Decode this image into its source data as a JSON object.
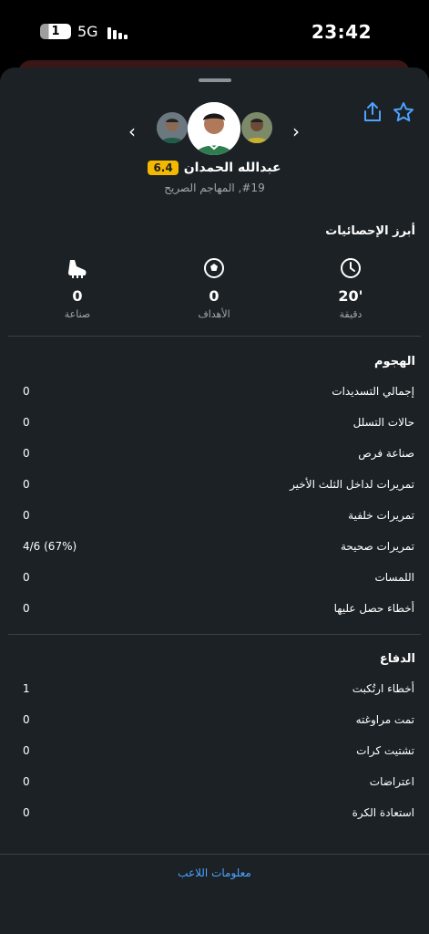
{
  "status_bar": {
    "sim": "1",
    "network": "5G",
    "time": "23:42"
  },
  "player": {
    "name": "عبدالله الحمدان",
    "rating": "6.4",
    "position": "#19, المهاجم الصريح"
  },
  "colors": {
    "accent": "#4da3ff",
    "rating_bg": "#f5b800",
    "sheet_bg": "#1b2125"
  },
  "top_stats": {
    "title": "أبرز الإحصائيات",
    "items": [
      {
        "icon": "boot-icon",
        "value": "0",
        "label": "صناعة"
      },
      {
        "icon": "football-icon",
        "value": "0",
        "label": "الأهداف"
      },
      {
        "icon": "clock-icon",
        "value": "20'",
        "label": "دقيقة"
      }
    ]
  },
  "attack": {
    "title": "الهجوم",
    "rows": [
      {
        "label": "إجمالي التسديدات",
        "value": "0"
      },
      {
        "label": "حالات التسلل",
        "value": "0"
      },
      {
        "label": "صناعة فرص",
        "value": "0"
      },
      {
        "label": "تمريرات لداخل الثلث الأخير",
        "value": "0"
      },
      {
        "label": "تمريرات خلفية",
        "value": "0"
      },
      {
        "label": "تمريرات صحيحة",
        "value": "4/6 (67%)"
      },
      {
        "label": "اللمسات",
        "value": "0"
      },
      {
        "label": "أخطاء حصل عليها",
        "value": "0"
      }
    ]
  },
  "defense": {
    "title": "الدفاع",
    "rows": [
      {
        "label": "أخطاء ارتُكبت",
        "value": "1"
      },
      {
        "label": "تمت مراوغته",
        "value": "0"
      },
      {
        "label": "تشتيت كرات",
        "value": "0"
      },
      {
        "label": "اعتراضات",
        "value": "0"
      },
      {
        "label": "استعادة الكرة",
        "value": "0"
      }
    ]
  },
  "footer": {
    "link": "معلومات اللاعب"
  }
}
